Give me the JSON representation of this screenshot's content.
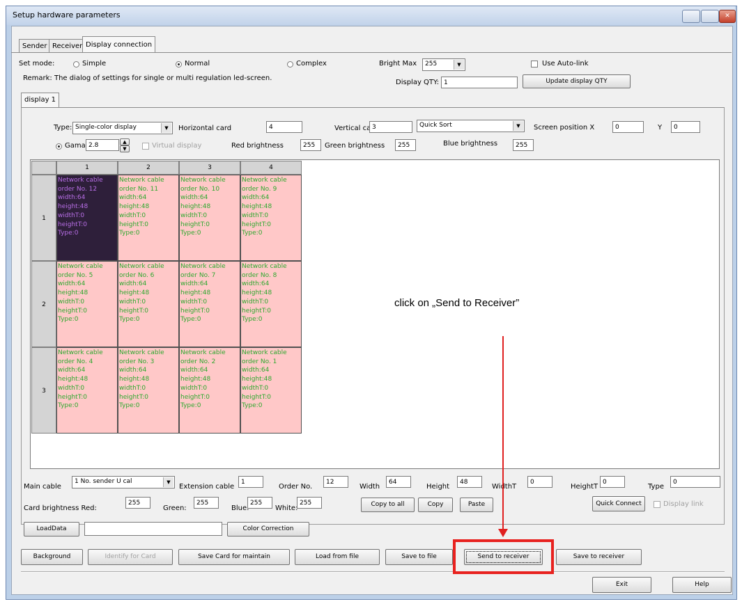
{
  "window": {
    "title": "Setup hardware parameters"
  },
  "tabs": [
    "Sender",
    "Receiver",
    "Display connection"
  ],
  "set_mode": {
    "label": "Set mode:",
    "options": [
      "Simple",
      "Normal",
      "Complex"
    ],
    "selected": "Normal"
  },
  "bright_max": {
    "label": "Bright Max",
    "value": "255"
  },
  "use_autolink": "Use Auto-link",
  "remark": "Remark: The dialog of settings for single or multi regulation led-screen.",
  "display_qty": {
    "label": "Display QTY:",
    "value": "1"
  },
  "update_qty_button": "Update display QTY",
  "display_tab": "display 1",
  "config": {
    "type_label": "Type:",
    "type_value": "Single-color display",
    "horizontal_label": "Horizontal card",
    "horizontal_value": "4",
    "vertical_label": "Vertical card",
    "vertical_value": "3",
    "sort_value": "Quick Sort",
    "screen_x_label": "Screen position X",
    "screen_x_value": "0",
    "y_label": "Y",
    "y_value": "0",
    "gama_label": "Gama",
    "gama_value": "2.8",
    "virtual_label": "Virtual display",
    "red_label": "Red brightness",
    "red_value": "255",
    "green_label": "Green brightness",
    "green_value": "255",
    "blue_label": "Blue brightness",
    "blue_value": "255"
  },
  "grid": {
    "col_headers": [
      "1",
      "2",
      "3",
      "4"
    ],
    "row_headers": [
      "1",
      "2",
      "3"
    ],
    "cell_prefix": "Network cable",
    "order_prefix": "order No. ",
    "cell_lines": [
      "width:64",
      "height:48",
      "widthT:0",
      "heightT:0",
      "Type:0"
    ],
    "orders": [
      [
        12,
        11,
        10,
        9
      ],
      [
        5,
        6,
        7,
        8
      ],
      [
        4,
        3,
        2,
        1
      ]
    ],
    "selected": [
      0,
      0
    ]
  },
  "bottom": {
    "main_cable_label": "Main cable",
    "main_cable_value": "1 No. sender U cal",
    "extension_label": "Extension cable",
    "extension_value": "1",
    "order_label": "Order No.",
    "order_value": "12",
    "width_label": "Width",
    "width_value": "64",
    "height_label": "Height",
    "height_value": "48",
    "widtht_label": "WidthT",
    "widtht_value": "0",
    "heightt_label": "HeightT",
    "heightt_value": "0",
    "type_label": "Type",
    "type_value": "0",
    "card_red_label": "Card brightness Red:",
    "card_red_value": "255",
    "green_label": "Green:",
    "green_value": "255",
    "blue_label": "Blue:",
    "blue_value": "255",
    "white_label": "White:",
    "white_value": "255",
    "copy_to_all": "Copy to all",
    "copy": "Copy",
    "paste": "Paste",
    "quick_connect": "Quick Connect",
    "display_link": "Display link",
    "load_data": "LoadData",
    "color_correction": "Color Correction"
  },
  "actions": {
    "background": "Background",
    "identify": "Identify for Card",
    "save_card": "Save Card for maintain",
    "load_file": "Load from file",
    "save_file": "Save to file",
    "send_receiver": "Send to receiver",
    "save_receiver": "Save to receiver",
    "exit": "Exit",
    "help": "Help"
  },
  "annotation": {
    "text": "click on „Send to Receiver”",
    "color": "#e02020"
  }
}
